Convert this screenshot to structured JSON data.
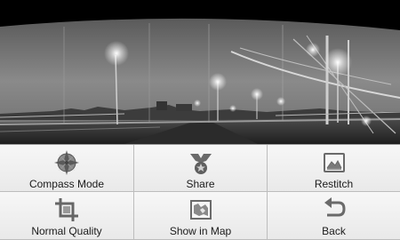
{
  "panorama": {
    "icon": "night-bridge-panorama"
  },
  "menu": {
    "items": [
      {
        "label": "Compass Mode",
        "icon": "compass-icon"
      },
      {
        "label": "Share",
        "icon": "share-icon"
      },
      {
        "label": "Restitch",
        "icon": "restitch-icon"
      },
      {
        "label": "Normal Quality",
        "icon": "crop-quality-icon"
      },
      {
        "label": "Show in Map",
        "icon": "map-icon"
      },
      {
        "label": "Back",
        "icon": "back-arrow-icon"
      }
    ]
  },
  "colors": {
    "menu_background": "#f2f2f2",
    "icon_gray": "#6a6a6a",
    "divider": "#bdbdbd"
  }
}
